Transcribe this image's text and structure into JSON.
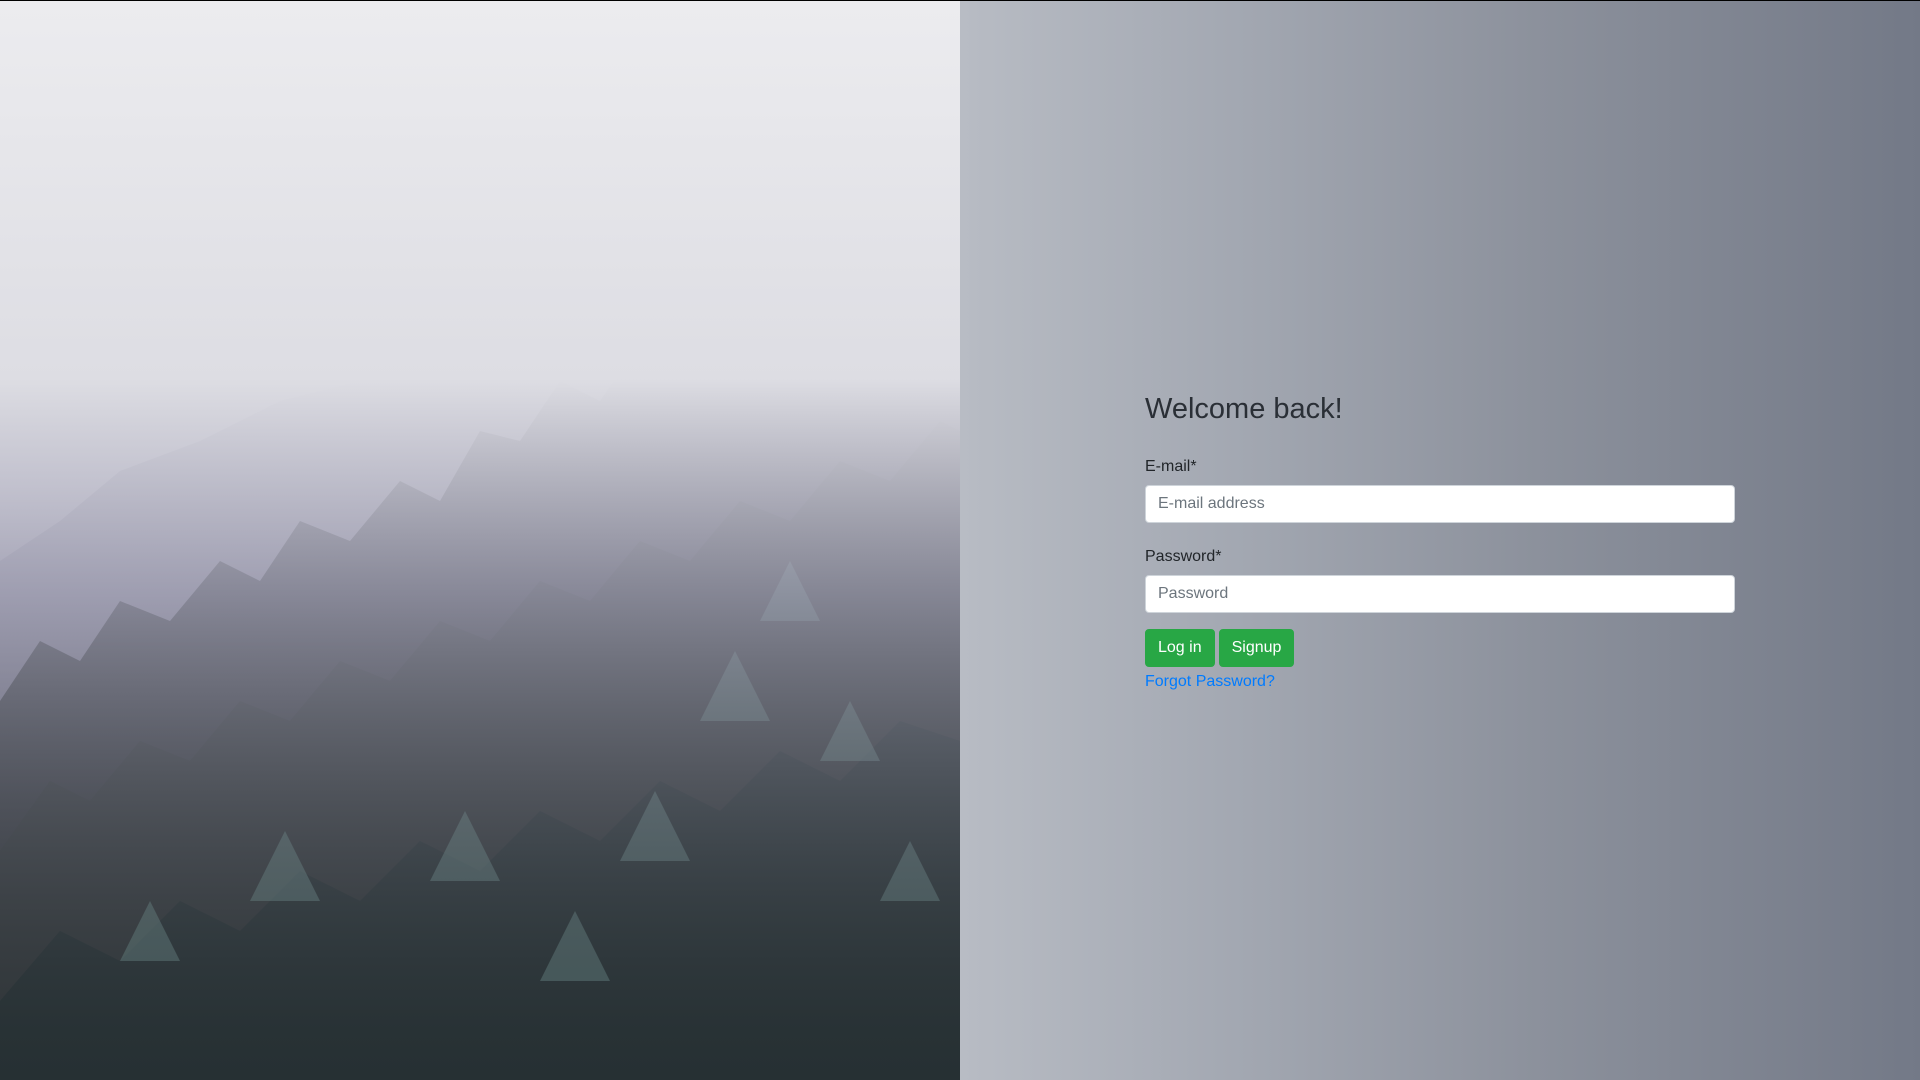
{
  "login": {
    "heading": "Welcome back!",
    "email_label": "E-mail*",
    "email_placeholder": "E-mail address",
    "email_value": "",
    "password_label": "Password*",
    "password_placeholder": "Password",
    "password_value": "",
    "login_button": "Log in",
    "signup_button": "Signup",
    "forgot_link": "Forgot Password?"
  },
  "colors": {
    "accent_green": "#28a745",
    "link_blue": "#007bff"
  },
  "image": {
    "subject": "misty-pine-forest"
  }
}
